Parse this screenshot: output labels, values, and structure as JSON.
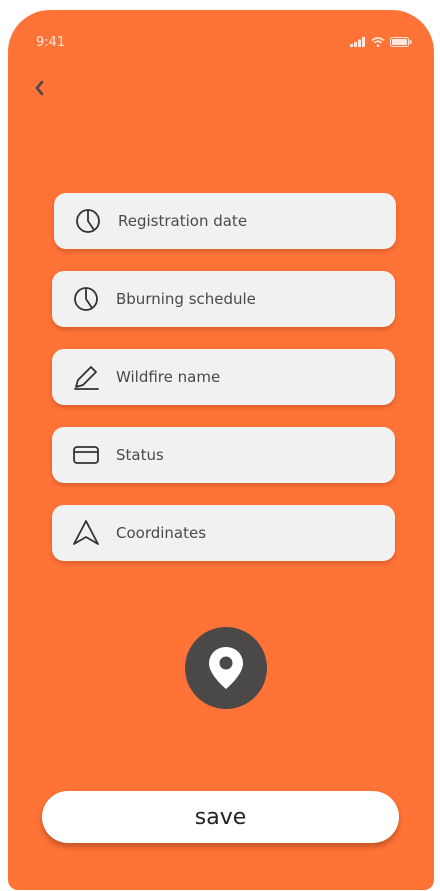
{
  "status_bar": {
    "time": "9:41",
    "icons": [
      "signal-icon",
      "wifi-icon",
      "battery-icon"
    ]
  },
  "nav": {
    "back_icon": "chevron-left-icon"
  },
  "fields": [
    {
      "label": "Registration date",
      "icon": "clock-icon"
    },
    {
      "label": "Bburning schedule",
      "icon": "clock-icon"
    },
    {
      "label": "Wildfire name",
      "icon": "pencil-icon"
    },
    {
      "label": "Status",
      "icon": "card-icon"
    },
    {
      "label": "Coordinates",
      "icon": "navigation-icon"
    }
  ],
  "location_button": {
    "icon": "location-pin-icon"
  },
  "save_label": "save",
  "colors": {
    "background": "#FF7337",
    "field": "#F1F1F1",
    "location_button": "#4A4948",
    "save_button": "#FFFFFF"
  }
}
